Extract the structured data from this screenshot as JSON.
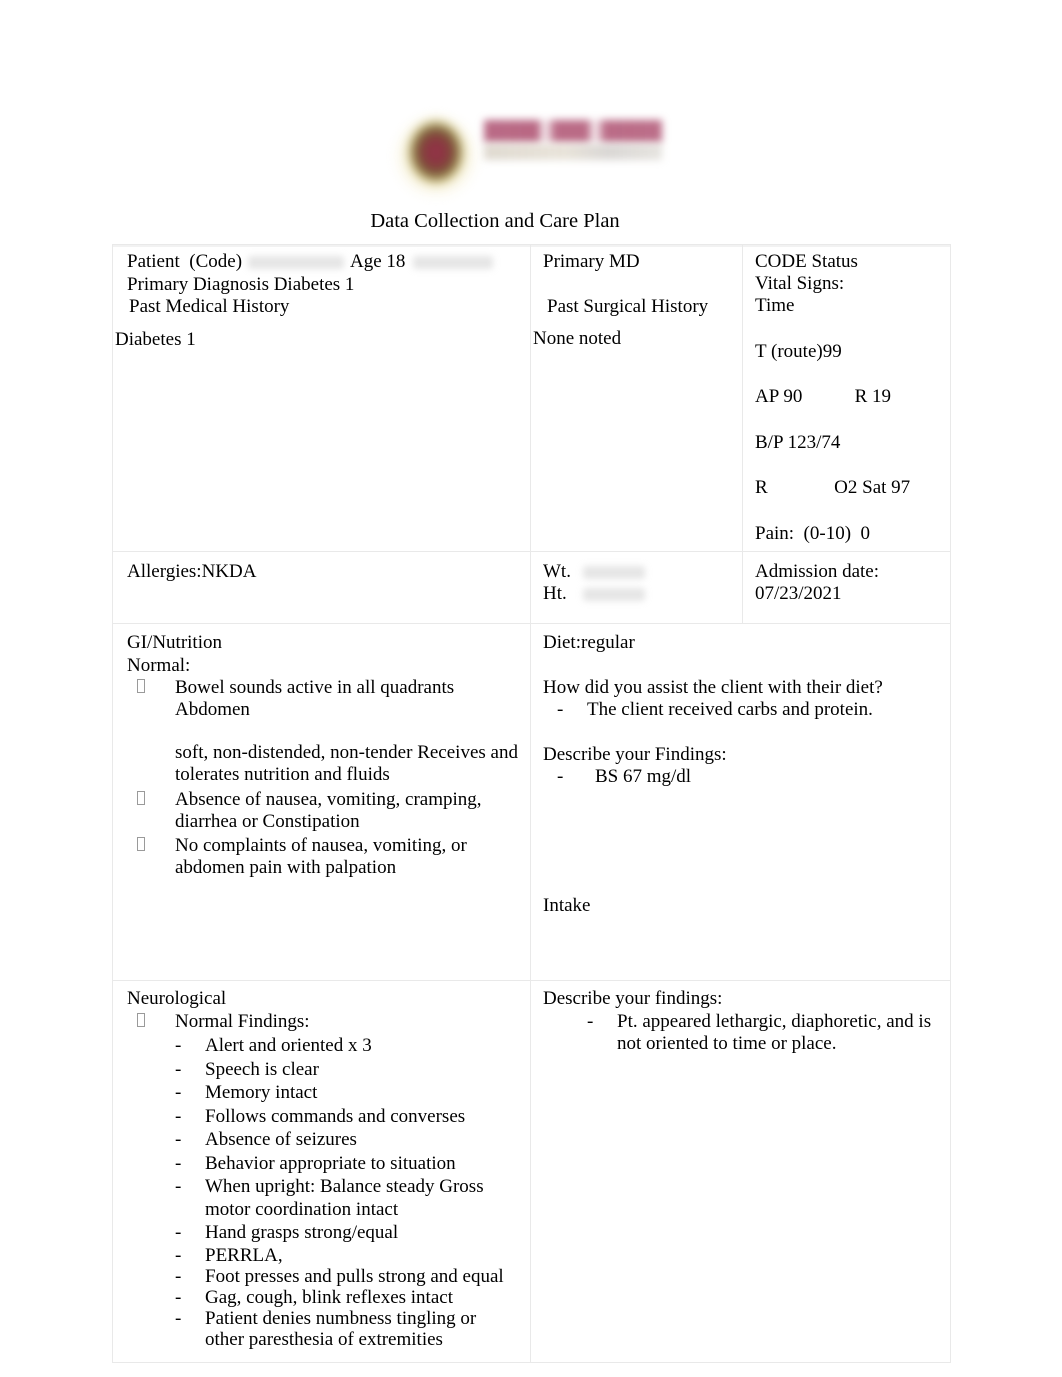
{
  "document": {
    "title": "Data Collection and Care Plan",
    "logo": {
      "crest_icon": "university-crest-icon",
      "wordmark_primary_color": "#a94668",
      "wordmark_secondary_color": "#c8c0b4",
      "crest_colors": [
        "#8d1f3d",
        "#6e5f2a",
        "#d6ba4e"
      ]
    }
  },
  "patient_row": {
    "patient_label": "Patient  (Code)",
    "age_label": "Age 18",
    "primary_diagnosis": "Primary Diagnosis Diabetes 1",
    "past_medical_history_label": "Past Medical History",
    "past_medical_history_value": "Diabetes 1",
    "primary_md_label": "Primary MD",
    "past_surgical_history_label": "Past Surgical History",
    "past_surgical_history_value": "None noted",
    "code_status_label": "CODE Status",
    "vital_signs_label": "Vital Signs:",
    "vitals": [
      "Time",
      "T (route)99",
      "AP 90           R 19",
      "B/P 123/74",
      "R              O2 Sat 97",
      "Pain:  (0-10)  0"
    ]
  },
  "measurements_row": {
    "allergies": "Allergies:NKDA",
    "weight_label": "Wt.",
    "height_label": "Ht.",
    "admission_date_label": "Admission date:",
    "admission_date_value": "07/23/2021"
  },
  "gi_row": {
    "heading": "GI/Nutrition",
    "normal_label": "Normal:",
    "normal_findings": [
      "Bowel sounds active in all quadrants Abdomen",
      "soft, non-distended, non-tender Receives and tolerates nutrition and fluids",
      "Absence of nausea, vomiting, cramping, diarrhea or Constipation",
      "No complaints of nausea, vomiting, or abdomen pain with palpation"
    ],
    "diet_label": "Diet:regular",
    "assist_question": "How did you assist the client with their diet?",
    "assist_answer": "The client received carbs and protein.",
    "findings_question": "Describe your Findings:",
    "findings_answer": "BS 67 mg/dl",
    "intake_label": "Intake"
  },
  "neuro_row": {
    "heading": "Neurological",
    "normal_findings_label": "Normal Findings:",
    "normal_findings": [
      "Alert and oriented x 3",
      "Speech  is clear",
      "Memory  intact",
      "Follows commands and converses",
      "Absence of seizures",
      "Behavior appropriate to situation",
      "When upright: Balance steady Gross motor coordination intact",
      "Hand grasps strong/equal",
      "PERRLA,",
      "Foot presses and pulls strong and equal",
      "Gag, cough, blink reflexes intact",
      "Patient denies numbness tingling or other paresthesia of extremities"
    ],
    "findings_question": "Describe your findings:",
    "findings_answer": "Pt. appeared lethargic, diaphoretic, and is not oriented to time or place."
  }
}
